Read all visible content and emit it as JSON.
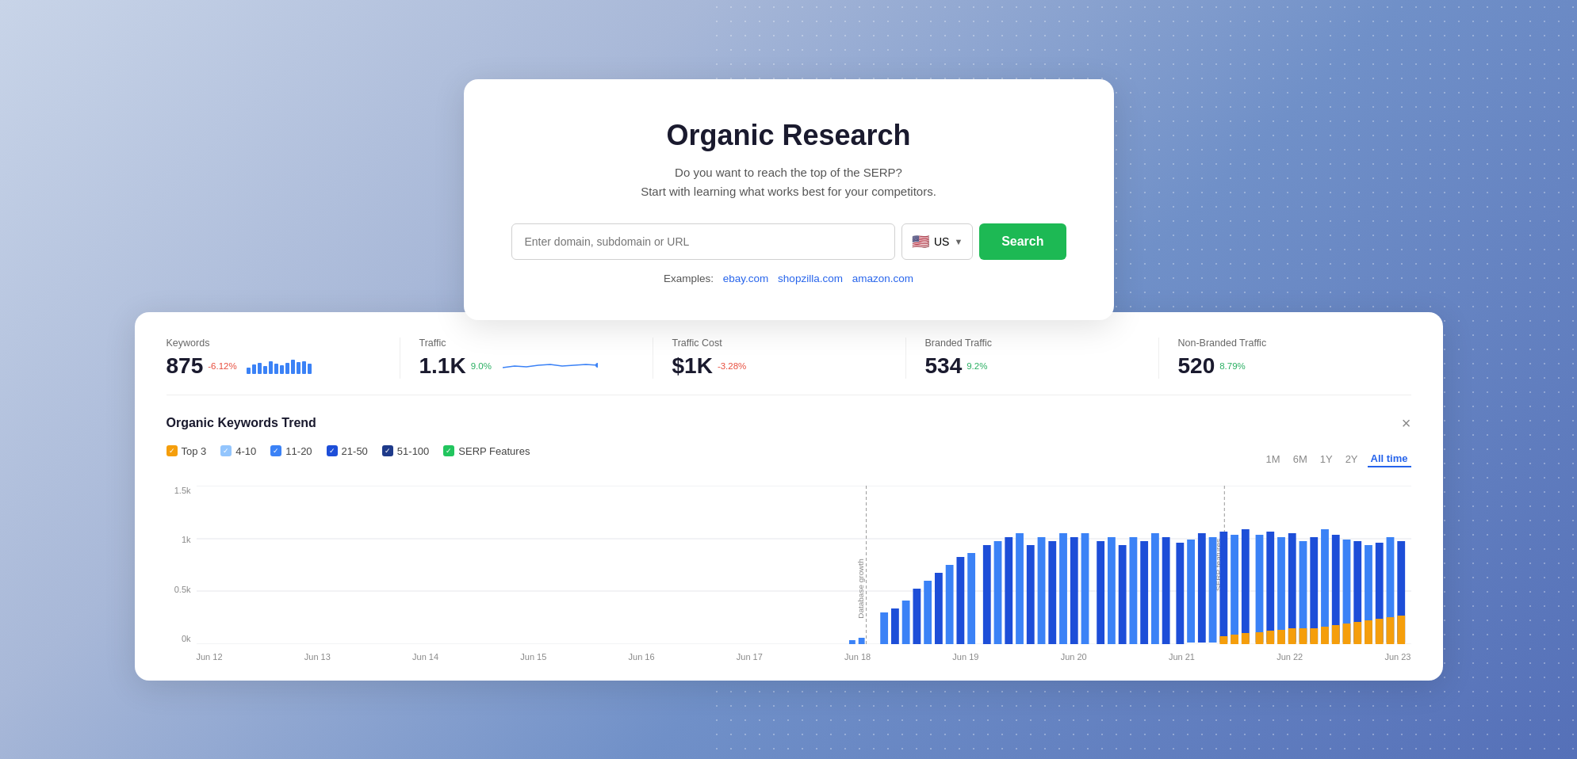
{
  "page": {
    "title": "Organic Research"
  },
  "search_card": {
    "title": "Organic Research",
    "subtitle_line1": "Do you want to reach the top of the SERP?",
    "subtitle_line2": "Start with learning what works best for your competitors.",
    "input_placeholder": "Enter domain, subdomain or URL",
    "country_label": "US",
    "search_button": "Search",
    "examples_label": "Examples:",
    "example_links": [
      "ebay.com",
      "shopzilla.com",
      "amazon.com"
    ]
  },
  "stats": [
    {
      "label": "Keywords",
      "value": "875",
      "change": "-6.12%",
      "change_type": "neg",
      "has_bars": true
    },
    {
      "label": "Traffic",
      "value": "1.1K",
      "change": "9.0%",
      "change_type": "pos",
      "has_line": true
    },
    {
      "label": "Traffic Cost",
      "value": "$1K",
      "change": "-3.28%",
      "change_type": "neg"
    },
    {
      "label": "Branded Traffic",
      "value": "534",
      "change": "9.2%",
      "change_type": "pos"
    },
    {
      "label": "Non-Branded Traffic",
      "value": "520",
      "change": "8.79%",
      "change_type": "pos"
    }
  ],
  "chart": {
    "title": "Organic Keywords Trend",
    "legend": [
      {
        "label": "Top 3",
        "color": "#f59e0b",
        "type": "check"
      },
      {
        "label": "4-10",
        "color": "#93c5fd",
        "type": "check"
      },
      {
        "label": "11-20",
        "color": "#3b82f6",
        "type": "check"
      },
      {
        "label": "21-50",
        "color": "#1d4ed8",
        "type": "check"
      },
      {
        "label": "51-100",
        "color": "#1e3a8a",
        "type": "check"
      },
      {
        "label": "SERP Features",
        "color": "#22c55e",
        "type": "check"
      }
    ],
    "time_filters": [
      "1M",
      "6M",
      "1Y",
      "2Y",
      "All time"
    ],
    "active_filter": "All time",
    "x_labels": [
      "Jun 12",
      "Jun 13",
      "Jun 14",
      "Jun 15",
      "Jun 16",
      "Jun 17",
      "Jun 18",
      "Jun 19",
      "Jun 20",
      "Jun 21",
      "Jun 22",
      "Jun 23"
    ],
    "y_labels": [
      "1.5k",
      "1k",
      "0.5k",
      "0k"
    ],
    "annotation1": "Database growth",
    "annotation2": "SERP features"
  }
}
